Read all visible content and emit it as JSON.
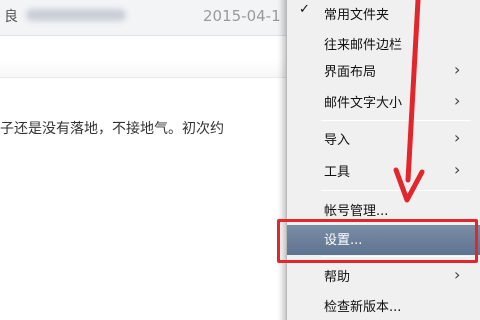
{
  "mail": {
    "sender_initial": "良",
    "date": "2015-04-1",
    "body_text": "子还是没有落地，不接地气。初次约"
  },
  "menu": {
    "items": [
      {
        "label": "常用文件夹",
        "checked": true,
        "submenu": false
      },
      {
        "label": "往来邮件边栏",
        "checked": false,
        "submenu": false
      },
      {
        "label": "界面布局",
        "checked": false,
        "submenu": true
      },
      {
        "label": "邮件文字大小",
        "checked": false,
        "submenu": true
      },
      {
        "label": "导入",
        "checked": false,
        "submenu": true
      },
      {
        "label": "工具",
        "checked": false,
        "submenu": true
      },
      {
        "label": "帐号管理...",
        "checked": false,
        "submenu": false
      },
      {
        "label": "设置...",
        "checked": false,
        "submenu": false,
        "highlighted": true
      },
      {
        "label": "帮助",
        "checked": false,
        "submenu": true
      },
      {
        "label": "检查新版本...",
        "checked": false,
        "submenu": false
      }
    ],
    "check_glyph": "✓",
    "arrow_glyph": "›"
  },
  "annotation": {
    "color": "#e3262c"
  }
}
